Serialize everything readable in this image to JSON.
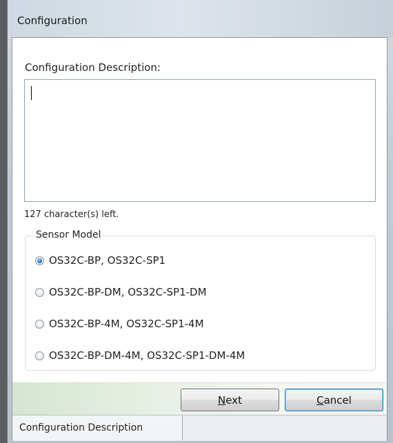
{
  "window": {
    "title": "Configuration"
  },
  "description": {
    "label": "Configuration Description:",
    "value": "",
    "chars_left": "127 character(s) left."
  },
  "sensor_model": {
    "legend": "Sensor Model",
    "options": [
      {
        "label": "OS32C-BP, OS32C-SP1",
        "checked": true
      },
      {
        "label": "OS32C-BP-DM, OS32C-SP1-DM",
        "checked": false
      },
      {
        "label": "OS32C-BP-4M, OS32C-SP1-4M",
        "checked": false
      },
      {
        "label": "OS32C-BP-DM-4M, OS32C-SP1-DM-4M",
        "checked": false
      }
    ]
  },
  "buttons": {
    "next_rest": "ext",
    "next_mnemonic": "N",
    "cancel_rest": "ancel",
    "cancel_mnemonic": "C"
  },
  "status_tabs": [
    {
      "label": "Configuration Description"
    }
  ]
}
